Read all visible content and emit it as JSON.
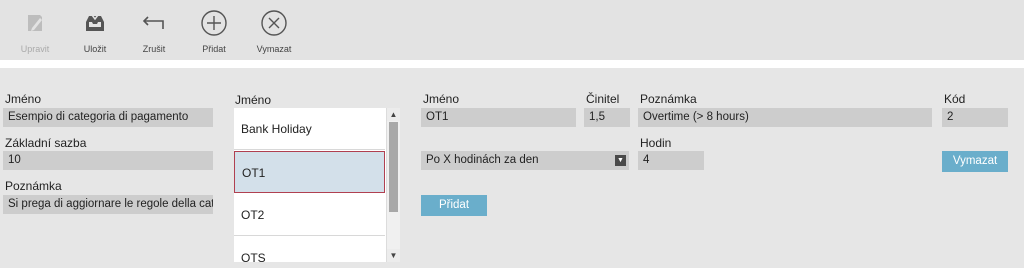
{
  "toolbar": {
    "items": [
      {
        "label": "Upravit",
        "icon": "pencil-icon",
        "enabled": false
      },
      {
        "label": "Uložit",
        "icon": "save-tray-icon",
        "enabled": true
      },
      {
        "label": "Zrušit",
        "icon": "undo-arrow-icon",
        "enabled": true
      },
      {
        "label": "Přidat",
        "icon": "plus-circle-icon",
        "enabled": true
      },
      {
        "label": "Vymazat",
        "icon": "x-circle-icon",
        "enabled": true
      }
    ]
  },
  "category": {
    "name_label": "Jméno",
    "name_value": "Esempio di categoria di pagamento",
    "base_rate_label": "Základní sazba",
    "base_rate_value": "10",
    "note_label": "Poznámka",
    "note_value": "Si prega di aggiornare le regole della cat"
  },
  "list": {
    "header": "Jméno",
    "items": [
      "Bank Holiday",
      "OT1",
      "OT2",
      "OTS"
    ],
    "selected": "OT1"
  },
  "detail": {
    "name_label": "Jméno",
    "name_value": "OT1",
    "factor_label": "Činitel",
    "factor_value": "1,5",
    "note_label": "Poznámka",
    "note_value": "Overtime (> 8 hours)",
    "code_label": "Kód",
    "code_value": "2",
    "rule_select_value": "Po X hodinách za den",
    "hours_label": "Hodin",
    "hours_value": "4",
    "delete_button": "Vymazat",
    "add_button": "Přidat"
  },
  "colors": {
    "button": "#6aaecb",
    "field": "#cdcdcd",
    "selected_row_bg": "#d3e0ea",
    "selected_row_border": "#b04050"
  }
}
